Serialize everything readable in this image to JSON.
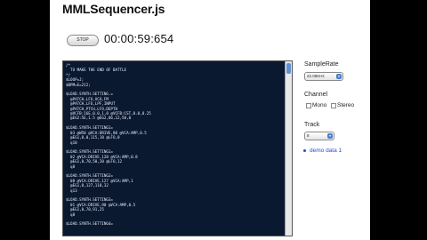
{
  "app": {
    "title": "MMLSequencer.js"
  },
  "transport": {
    "stop_label": "STOP",
    "time": "00:00:59:654"
  },
  "editor": {
    "lines": [
      "/*",
      "  TO MAKE THE END OF BATTLE",
      "*/",
      "$LOOP=J;",
      "$BPM=E=212;",
      "",
      "$LOAD.SYNTH.SETTING.=",
      "  @PATCH,LFO,VCO,FM",
      "  @PATCH,LFO,LPF,INPUT",
      "  @PATCH,PTCH,LFO,DEPTH",
      "  @VCFB:16E,0.0,1,0 @VCFB:CST,0.0,0.25",
      "  @EG2:5E,1.5 @EG2,06,12,50,0",
      "",
      "$LOAD.SYNTH.SETTING1=",
      "  03 @W50 @VCA:DRIVE,80 @VCA:AMP,0.5",
      "  @EG1,0,0,115,10 @LFO,0",
      "  q10",
      "",
      "$LOAD.SYNTH.SETTING1=",
      "  02 @VCA:DRIVE,120 @VCA:AMP,0.8",
      "  @EG1,0,70,50,20 @LFO,12",
      "  q8",
      "",
      "$LOAD.SYNTH.SETTING2=",
      "  08 @VCA:DRIVE,127 @VCA:AMP,1",
      "  @EG1,0,127,110,32",
      "  q13",
      "",
      "$LOAD.SYNTH.SETTING3=",
      "  01 @VCA:DRIVE,90 @VCA:AMP,0.5",
      "  @EG1,0,70,91,25",
      "  q8",
      "",
      "$LOAD.SYNTH.SETTING4="
    ]
  },
  "sidebar": {
    "sample_rate_label": "SampleRate",
    "sample_rate_value": "22.05KHz",
    "channel_label": "Channel",
    "mono_label": "Mono",
    "stereo_label": "Stereo",
    "track_label": "Track",
    "track_value": "8",
    "demo_link": "demo data 1"
  }
}
